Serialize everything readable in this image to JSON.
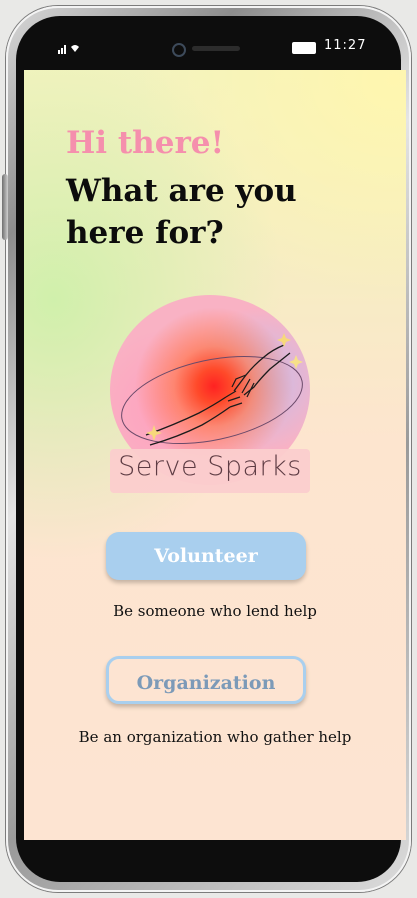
{
  "status_bar": {
    "time": "11:27",
    "signal_icon": "signal-wifi-icon",
    "battery_icon": "battery-icon"
  },
  "screen": {
    "greeting": "Hi there!",
    "headline": "What are you here for?",
    "logo_text": "Serve Sparks",
    "volunteer_button": "Volunteer",
    "volunteer_caption": "Be someone who lend help",
    "organization_button": "Organization",
    "organization_caption": "Be an organization who gather help"
  },
  "colors": {
    "greeting": "#f58fad",
    "volunteer_button_bg": "#a9cfee",
    "organization_text": "#7c9ab8"
  }
}
